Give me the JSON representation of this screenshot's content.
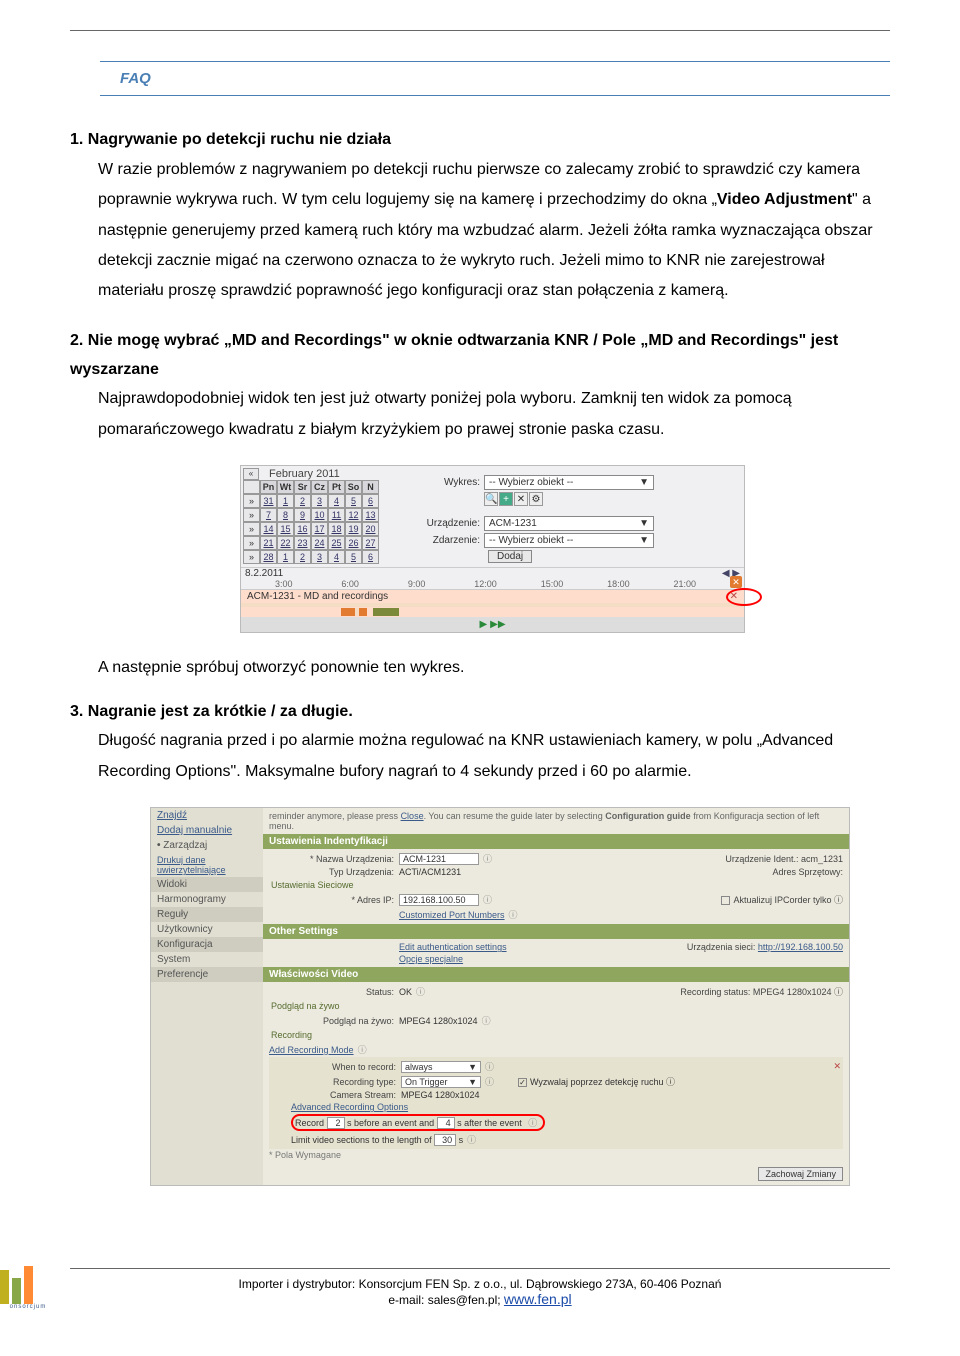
{
  "faq": {
    "header": "FAQ",
    "items": [
      {
        "num": "1.",
        "title": "Nagrywanie po detekcji ruchu nie działa",
        "body_html": "W razie problemów z nagrywaniem po detekcji ruchu pierwsze co zalecamy zrobić to sprawdzić czy kamera poprawnie wykrywa ruch. W tym celu logujemy się na kamerę i przechodzimy do okna „<b>Video Adjustment</b>\" a następnie generujemy przed kamerą ruch który ma wzbudzać alarm. Jeżeli żółta ramka wyznaczająca obszar detekcji zacznie migać na czerwono oznacza to że wykryto ruch.  Jeżeli mimo to KNR nie zarejestrował materiału proszę sprawdzić poprawność jego konfiguracji oraz stan połączenia z kamerą."
      },
      {
        "num": "2.",
        "title": "Nie mogę wybrać „MD and Recordings\" w oknie odtwarzania KNR / Pole „MD and Recordings\" jest wyszarzane",
        "body": "Najprawdopodobniej widok ten jest już otwarty poniżej pola wyboru. Zamknij ten widok za pomocą pomarańczowego kwadratu z białym krzyżykiem po prawej stronie paska czasu.",
        "after": "A następnie spróbuj otworzyć ponownie ten wykres."
      },
      {
        "num": "3.",
        "title": "Nagranie jest za krótkie / za długie.",
        "body": "Długość nagrania przed i po alarmie można regulować na KNR ustawieniach kamery, w polu „Advanced Recording Options\". Maksymalne bufory nagrań to 4 sekundy przed i 60 po alarmie."
      }
    ]
  },
  "shot1": {
    "month": "February 2011",
    "days_hdr": [
      "Pn",
      "Wt",
      "Sr",
      "Cz",
      "Pt",
      "So",
      "N"
    ],
    "weeks": [
      [
        "31",
        "1",
        "2",
        "3",
        "4",
        "5",
        "6"
      ],
      [
        "7",
        "8",
        "9",
        "10",
        "11",
        "12",
        "13"
      ],
      [
        "14",
        "15",
        "16",
        "17",
        "18",
        "19",
        "20"
      ],
      [
        "21",
        "22",
        "23",
        "24",
        "25",
        "26",
        "27"
      ],
      [
        "28",
        "1",
        "2",
        "3",
        "4",
        "5",
        "6"
      ]
    ],
    "wykres_label": "Wykres:",
    "wykres_val": "-- Wybierz obiekt --",
    "urz_label": "Urządzenie:",
    "urz_val": "ACM-1231",
    "zdarz_label": "Zdarzenie:",
    "zdarz_val": "-- Wybierz obiekt --",
    "dodaj": "Dodaj",
    "date": "8.2.2011",
    "times": [
      "3:00",
      "6:00",
      "9:00",
      "12:00",
      "15:00",
      "18:00",
      "21:00"
    ],
    "track_label": "ACM-1231 - MD and recordings"
  },
  "shot2": {
    "side": {
      "znajdz": "Znajdź",
      "dodaj": "Dodaj manualnie",
      "zarz": "Zarządzaj",
      "drukuj": "Drukuj dane uwierzytelniające",
      "widoki": "Widoki",
      "harm": "Harmonogramy",
      "reguly": "Reguły",
      "uzyt": "Użytkownicy",
      "konf": "Konfiguracja",
      "system": "System",
      "pref": "Preferencje"
    },
    "hint_pre": "reminder anymore, please press ",
    "hint_close": "Close",
    "hint_post": ". You can resume the guide later by selecting ",
    "hint_b": "Configuration guide",
    "hint_end": " from Konfiguracja section of left menu.",
    "sec_ident": "Ustawienia Indentyfikacji",
    "nazwa_lbl": "* Nazwa Urządzenia:",
    "nazwa_val": "ACM-1231",
    "ident_lbl": "Urządzenie Ident.: acm_1231",
    "typ_lbl": "Typ Urządzenia:",
    "typ_val": "ACTi/ACM1231",
    "adres_sprz": "Adres Sprzętowy:",
    "sec_siec": "Ustawienia Sieciowe",
    "ip_lbl": "* Adres IP:",
    "ip_val": "192.168.100.50",
    "aktual": "Aktualizuj IPCorder tylko",
    "custom_ports": "Customized Port Numbers",
    "sec_other": "Other Settings",
    "edit_auth": "Edit authentication settings",
    "urz_sieci": "Urządzenia sieci: ",
    "urz_link": "http://192.168.100.50",
    "opcje": "Opcje specjalne",
    "sec_video": "Właściwości Video",
    "status_lbl": "Status:",
    "status_val": "OK",
    "rec_status": "Recording status: MPEG4 1280x1024",
    "podglad": "Podgląd na żywo",
    "podglad2": "Podgląd na żywo: ",
    "podglad2_val": "MPEG4 1280x1024",
    "recording": "Recording",
    "add_mode": "Add Recording Mode",
    "when_lbl": "When to record:",
    "when_val": "always",
    "rectype_lbl": "Recording type:",
    "rectype_val": "On Trigger",
    "wyzw": "Wyzwalaj poprzez detekcję ruchu",
    "cam_lbl": "Camera Stream:",
    "cam_val": "MPEG4 1280x1024",
    "adv": "Advanced Recording Options",
    "record": "Record",
    "rec_before_v": "2",
    "rec_before": "s before an event and",
    "rec_after_v": "4",
    "rec_after": "s after the event",
    "limit": "Limit video sections to the length of",
    "limit_v": "30",
    "limit_s": "s",
    "pola": "* Pola Wymagane",
    "save": "Zachowaj Zmiany"
  },
  "footer": {
    "line1": "Importer i dystrybutor: Konsorcjum FEN Sp. z o.o., ul. Dąbrowskiego 273A, 60-406 Poznań",
    "line2_pre": "e-mail: sales@fen.pl; ",
    "line2_link": "www.fen.pl"
  }
}
